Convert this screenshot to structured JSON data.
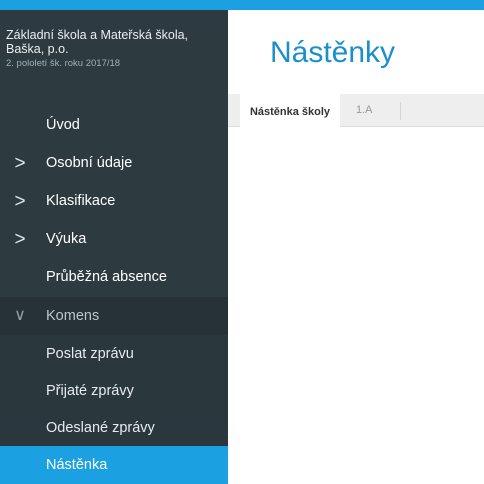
{
  "colors": {
    "accent": "#1ba1e2",
    "sidebar": "#2d3b41",
    "title": "#1a8fc9"
  },
  "school": {
    "name": "Základní škola a Mateřská škola, Baška, p.o.",
    "term": "2. pololetí šk. roku 2017/18"
  },
  "nav": {
    "chevron_right": ">",
    "chevron_down": "∨",
    "items": [
      {
        "label": "Úvod"
      },
      {
        "label": "Osobní údaje"
      },
      {
        "label": "Klasifikace"
      },
      {
        "label": "Výuka"
      },
      {
        "label": "Průběžná absence"
      },
      {
        "label": "Komens"
      }
    ],
    "sub_items": [
      {
        "label": "Poslat zprávu"
      },
      {
        "label": "Přijaté zprávy"
      },
      {
        "label": "Odeslané zprávy"
      },
      {
        "label": "Nástěnka"
      }
    ]
  },
  "main": {
    "title": "Nástěnky",
    "tabs": [
      {
        "label": "Nástěnka školy"
      },
      {
        "label": "1.A"
      }
    ]
  }
}
